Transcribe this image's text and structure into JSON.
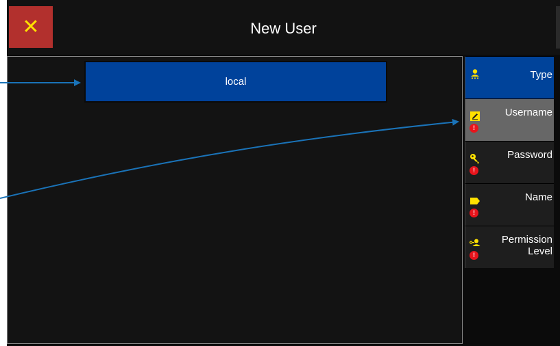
{
  "window": {
    "title": "New User",
    "close_icon": "close-icon"
  },
  "field": {
    "type_value": "local"
  },
  "sidebar": {
    "items": [
      {
        "label": "Type",
        "icon": "user-type-icon",
        "state": "active",
        "warning": false
      },
      {
        "label": "Username",
        "icon": "edit-icon",
        "state": "selected",
        "warning": true
      },
      {
        "label": "Password",
        "icon": "key-icon",
        "state": "normal",
        "warning": true
      },
      {
        "label": "Name",
        "icon": "tag-icon",
        "state": "normal",
        "warning": true
      },
      {
        "label_line1": "Permission",
        "label_line2": "Level",
        "icon": "permission-icon",
        "state": "normal",
        "warning": true
      }
    ],
    "warning_glyph": "!"
  },
  "colors": {
    "accent_blue": "#00429B",
    "close_red": "#B2302D",
    "icon_yellow": "#FFE100",
    "warning_red": "#E8141C",
    "selected_gray": "#676767",
    "annotation_arrow": "#1A73B8"
  }
}
